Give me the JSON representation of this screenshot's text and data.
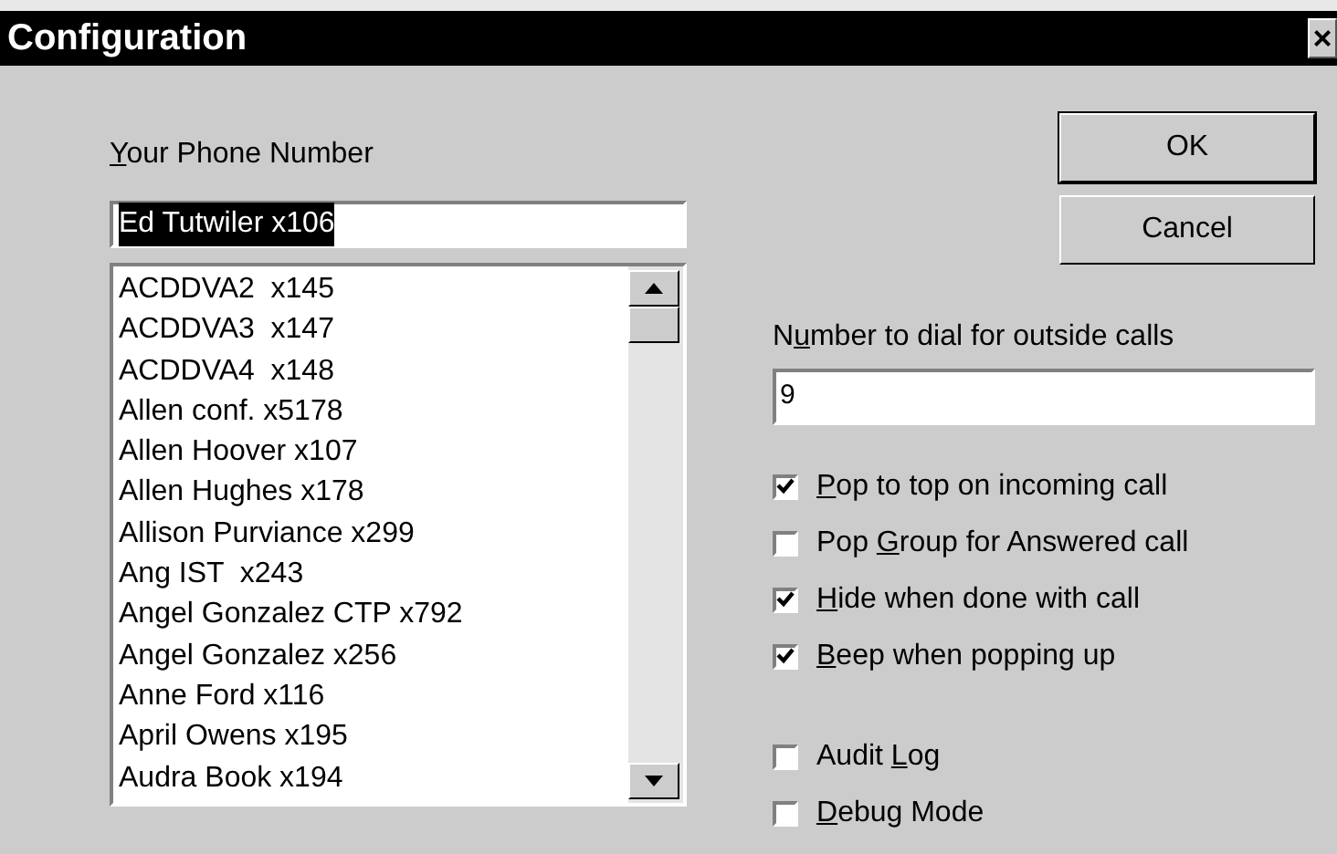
{
  "window": {
    "title": "Configuration",
    "close": "×"
  },
  "phone": {
    "label": {
      "key": "Y",
      "post": "our Phone Number"
    },
    "value": "Ed Tutwiler x106",
    "text_selected": true,
    "list": [
      "ACDDVA2  x145",
      "ACDDVA3  x147",
      "ACDDVA4  x148",
      "Allen conf. x5178",
      "Allen Hoover x107",
      "Allen Hughes x178",
      "Allison Purviance x299",
      "Ang IST  x243",
      "Angel Gonzalez CTP x792",
      "Angel Gonzalez x256",
      "Anne Ford x116",
      "April Owens x195",
      "Audra Book x194"
    ]
  },
  "buttons": [
    {
      "label": "OK",
      "default": true
    },
    {
      "label": "Cancel",
      "default": false
    }
  ],
  "outside": {
    "label": {
      "pre": "N",
      "key": "u",
      "post": "mber to dial for outside calls"
    },
    "value": "9"
  },
  "options": [
    {
      "label": {
        "key": "P",
        "post": "op to top on incoming call"
      },
      "checked": true
    },
    {
      "label": {
        "pre": "Pop ",
        "key": "G",
        "post": "roup for Answered call"
      },
      "checked": false
    },
    {
      "label": {
        "key": "H",
        "post": "ide when done with call"
      },
      "checked": true
    },
    {
      "label": {
        "key": "B",
        "post": "eep when popping up"
      },
      "checked": true
    }
  ],
  "debug_options": [
    {
      "label": {
        "pre": "Audit ",
        "key": "L",
        "post": "og"
      },
      "checked": false
    },
    {
      "label": {
        "key": "D",
        "post": "ebug Mode"
      },
      "checked": false
    }
  ]
}
